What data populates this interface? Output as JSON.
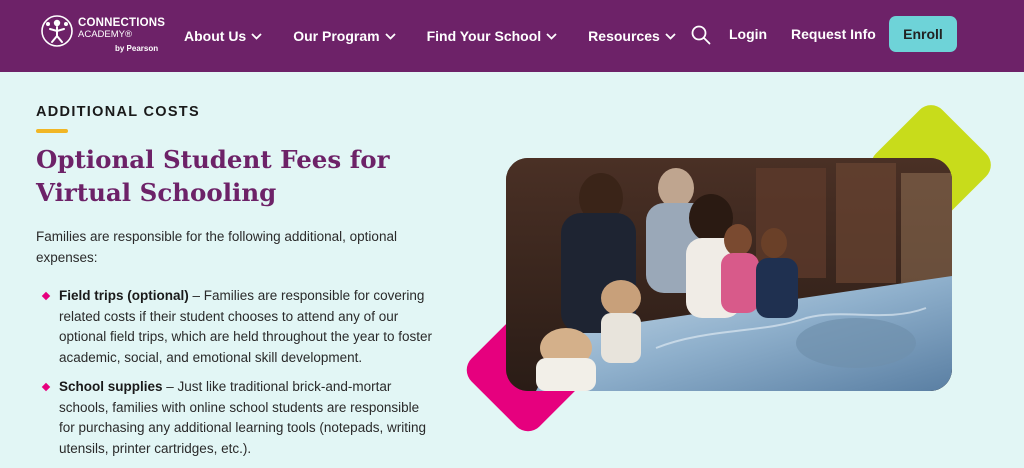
{
  "header": {
    "logo": {
      "line1": "CONNECTIONS",
      "line2": "ACADEMY®",
      "line3": "by Pearson"
    },
    "nav": [
      {
        "label": "About Us"
      },
      {
        "label": "Our Program"
      },
      {
        "label": "Find Your School"
      },
      {
        "label": "Resources"
      }
    ],
    "login_label": "Login",
    "request_label": "Request Info",
    "enroll_label": "Enroll"
  },
  "content": {
    "eyebrow": "ADDITIONAL COSTS",
    "title": "Optional Student Fees for Virtual Schooling",
    "intro": "Families are responsible for the following additional, optional expenses:",
    "items": [
      {
        "term": "Field trips (optional)",
        "text": " – Families are responsible for covering related costs if their student chooses to attend any of our optional field trips, which are held throughout the year to foster academic, social, and emotional skill development."
      },
      {
        "term": "School supplies",
        "text": " – Just like traditional brick-and-mortar schools, families with online school students are responsible for purchasing any additional learning tools (notepads, writing utensils, printer cartridges, etc.)."
      }
    ]
  },
  "icons": {
    "search": "search-icon",
    "chevron": "chevron-down-icon",
    "logo": "connections-academy-logo-icon"
  },
  "colors": {
    "header_bg": "#6d2268",
    "page_bg": "#e2f6f5",
    "enroll_bg": "#6ed3d8",
    "title": "#6d2268",
    "accent_pink": "#e6007e",
    "accent_green": "#c8dc1b",
    "accent_yellow": "#f1b625"
  }
}
